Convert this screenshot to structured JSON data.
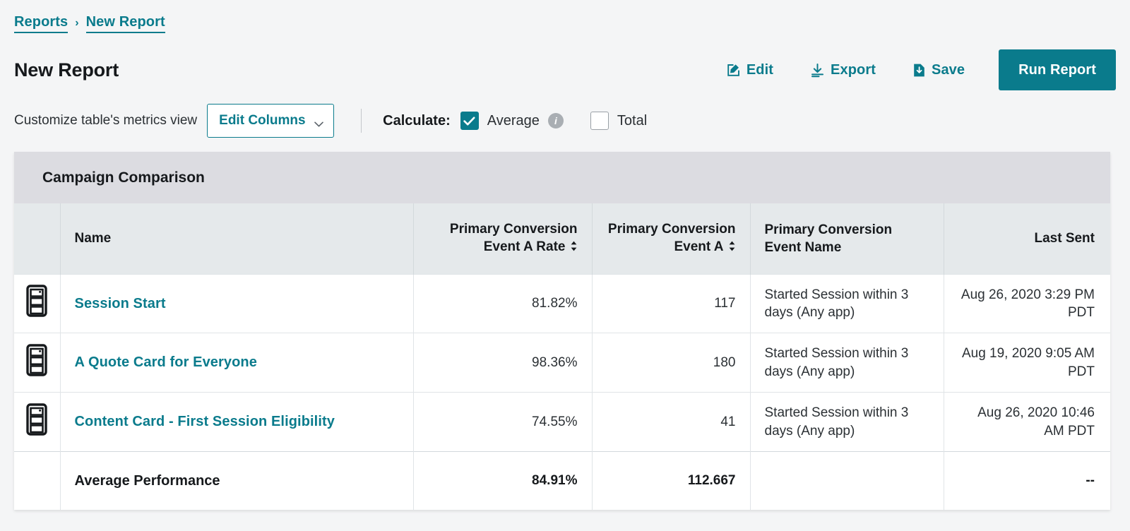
{
  "breadcrumb": {
    "parent": "Reports",
    "separator": "›",
    "current": "New Report"
  },
  "header": {
    "title": "New Report",
    "actions": [
      {
        "label": "Edit",
        "icon": "edit-icon"
      },
      {
        "label": "Export",
        "icon": "download-icon"
      },
      {
        "label": "Save",
        "icon": "save-icon"
      }
    ],
    "run_button": "Run Report"
  },
  "toolbar": {
    "customize_label": "Customize table's metrics view",
    "edit_columns": "Edit Columns",
    "calculate_label": "Calculate:",
    "average_label": "Average",
    "average_checked": true,
    "total_label": "Total",
    "total_checked": false,
    "info_glyph": "i"
  },
  "card": {
    "title": "Campaign Comparison",
    "columns": [
      {
        "key": "icon",
        "label": "",
        "sortable": false
      },
      {
        "key": "name",
        "label": "Name",
        "sortable": false
      },
      {
        "key": "rate",
        "label": "Primary Conversion Event A Rate",
        "sortable": true
      },
      {
        "key": "count",
        "label": "Primary Conversion Event A",
        "sortable": true
      },
      {
        "key": "event",
        "label": "Primary Conversion Event Name",
        "sortable": false
      },
      {
        "key": "sent",
        "label": "Last Sent",
        "sortable": false
      }
    ],
    "rows": [
      {
        "icon": "content-card-icon",
        "name": "Session Start",
        "rate": "81.82%",
        "count": "117",
        "event": "Started Session within 3 days (Any app)",
        "sent": "Aug 26, 2020 3:29 PM PDT"
      },
      {
        "icon": "content-card-icon",
        "name": "A Quote Card for Everyone",
        "rate": "98.36%",
        "count": "180",
        "event": "Started Session within 3 days (Any app)",
        "sent": "Aug 19, 2020 9:05 AM PDT"
      },
      {
        "icon": "content-card-icon",
        "name": "Content Card - First Session Eligibility",
        "rate": "74.55%",
        "count": "41",
        "event": "Started Session within 3 days (Any app)",
        "sent": "Aug 26, 2020 10:46 AM PDT"
      }
    ],
    "summary": {
      "label": "Average Performance",
      "rate": "84.91%",
      "count": "112.667",
      "event": "",
      "sent": "--"
    }
  },
  "colors": {
    "accent": "#0a7b8c",
    "page_bg": "#f4f5f6",
    "card_header_bg": "#dcdce1",
    "table_header_bg": "#e5e9eb",
    "text": "#16191c"
  }
}
